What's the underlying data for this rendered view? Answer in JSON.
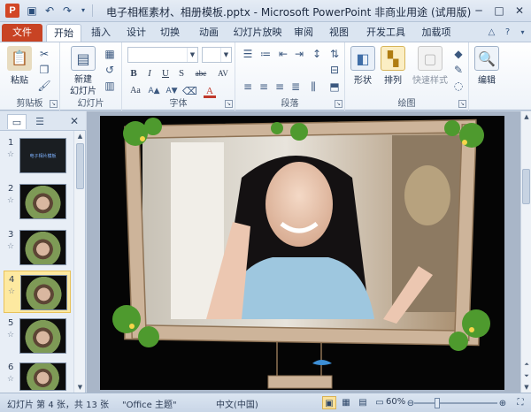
{
  "titlebar": {
    "app_icon": "P",
    "title": "电子相框素材、相册模板.pptx - Microsoft PowerPoint 非商业用途 (试用版)",
    "qat_icons": [
      "save-icon",
      "undo-icon",
      "redo-icon",
      "customize-icon"
    ],
    "window_buttons": [
      "minimize-icon",
      "maximize-icon",
      "close-icon"
    ]
  },
  "tabs": {
    "file": "文件",
    "items": [
      "开始",
      "插入",
      "设计",
      "切换",
      "动画",
      "幻灯片放映",
      "审阅",
      "视图",
      "开发工具",
      "加载项"
    ],
    "active_index": 0
  },
  "ribbon": {
    "clipboard": {
      "label": "剪贴板",
      "paste": "粘贴"
    },
    "slides": {
      "label": "幻灯片",
      "new_slide_line1": "新建",
      "new_slide_line2": "幻灯片"
    },
    "font": {
      "label": "字体",
      "font_name": "",
      "font_size": "",
      "buttons": [
        "B",
        "I",
        "U",
        "S",
        "abc",
        "AV",
        "Aa",
        "A"
      ]
    },
    "paragraph": {
      "label": "段落"
    },
    "drawing": {
      "label": "绘图",
      "shapes": "形状",
      "arrange": "排列",
      "quick_styles": "快速样式"
    },
    "editing": {
      "label": "编辑"
    }
  },
  "slide_panel": {
    "slides": [
      {
        "num": "1",
        "style": "dark",
        "title": "电子相片模板"
      },
      {
        "num": "2",
        "style": "photo"
      },
      {
        "num": "3",
        "style": "photo"
      },
      {
        "num": "4",
        "style": "photo",
        "selected": true
      },
      {
        "num": "5",
        "style": "photo"
      },
      {
        "num": "6",
        "style": "photo"
      }
    ],
    "star": "☆"
  },
  "status": {
    "slide_info": "幻灯片 第 4 张，共 13 张",
    "theme": "\"Office 主题\"",
    "language": "中文(中国)",
    "zoom": "60%",
    "zoom_level": 0.6
  },
  "colors": {
    "file_tab": "#c84324",
    "selection": "#fde9a0",
    "slide_bg": "#050505"
  }
}
